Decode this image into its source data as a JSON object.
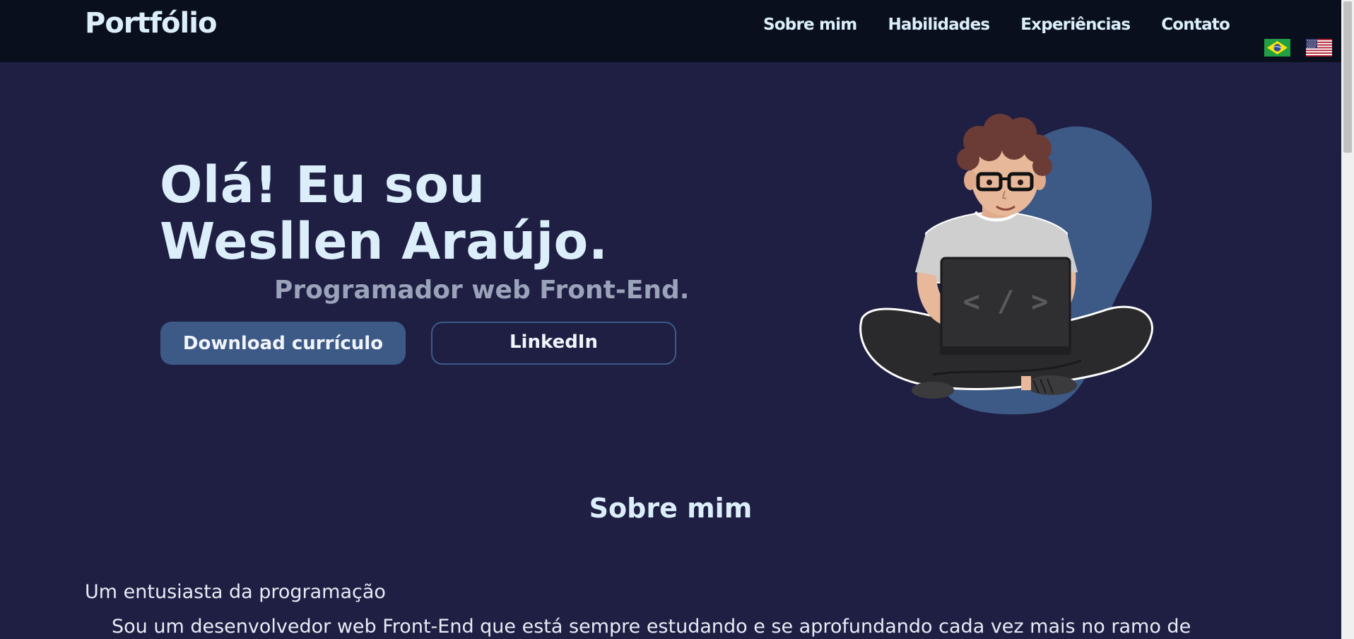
{
  "header": {
    "brand": "Portfólio",
    "nav": [
      "Sobre mim",
      "Habilidades",
      "Experiências",
      "Contato"
    ],
    "languages": [
      "pt-BR flag",
      "en-US flag"
    ]
  },
  "hero": {
    "title_line1": "Olá! Eu sou",
    "title_line2": "Wesllen Araújo.",
    "subtitle": "Programador web Front-End.",
    "download_label": "Download currículo",
    "linkedin_label": "LinkedIn",
    "laptop_code": "< / >"
  },
  "about": {
    "title": "Sobre mim",
    "heading": "Um entusiasta da programação",
    "text": "Sou um desenvolvedor web Front-End que está sempre estudando e se aprofundando cada vez mais no ramo de"
  },
  "colors": {
    "background": "#1f1f44",
    "navbar": "#090f1d",
    "accent": "#3d5a87",
    "text": "#dbeefa",
    "subtitle": "#9aa3b9"
  }
}
